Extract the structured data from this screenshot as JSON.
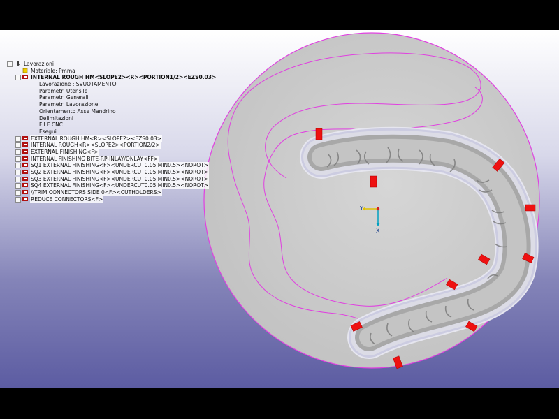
{
  "tree": {
    "root": "Lavorazioni",
    "material": "Materiale: Pmma",
    "active_op": "INTERNAL ROUGH HM<SLOPE2><R><PORTION1/2><EZS0.03>",
    "sub_items": [
      "Lavorazione  : SVUOTAMENTO",
      "Parametri Utensile",
      "Parametri Generali",
      "Parametri Lavorazione",
      "Orientamento Asse Mandrino",
      "Delimitazioni",
      "FILE CNC",
      "Esegui"
    ],
    "operations": [
      "EXTERNAL ROUGH HM<R><SLOPE2><EZS0.03>",
      "INTERNAL ROUGH<R><SLOPE2><PORTION2/2>",
      "EXTERNAL FINISHING<F>",
      "INTERNAL FINISHING BITE-RP-INLAY/ONLAY<FF>",
      "SQ1 EXTERNAL FINISHING<F><UNDERCUT0.05,MIN0.5><NOROT>",
      "SQ2 EXTERNAL FINISHING<F><UNDERCUT0.05,MIN0.5><NOROT>",
      "SQ3 EXTERNAL FINISHING<F><UNDERCUT0.05,MIN0.5><NOROT>",
      "SQ4 EXTERNAL FINISHING<F><UNDERCUT0.05,MIN0.5><NOROT>",
      "//TRIM CONNECTORS SIDE 0<F><CUTHOLDERS>",
      "REDUCE CONNECTORS<F>"
    ]
  },
  "axes": {
    "x_label": "Y",
    "y_label": "X"
  },
  "colors": {
    "disc": "#cfcfcf",
    "boundary": "#e040e0",
    "connector": "#ee1111",
    "model": "#b8b8b8"
  }
}
